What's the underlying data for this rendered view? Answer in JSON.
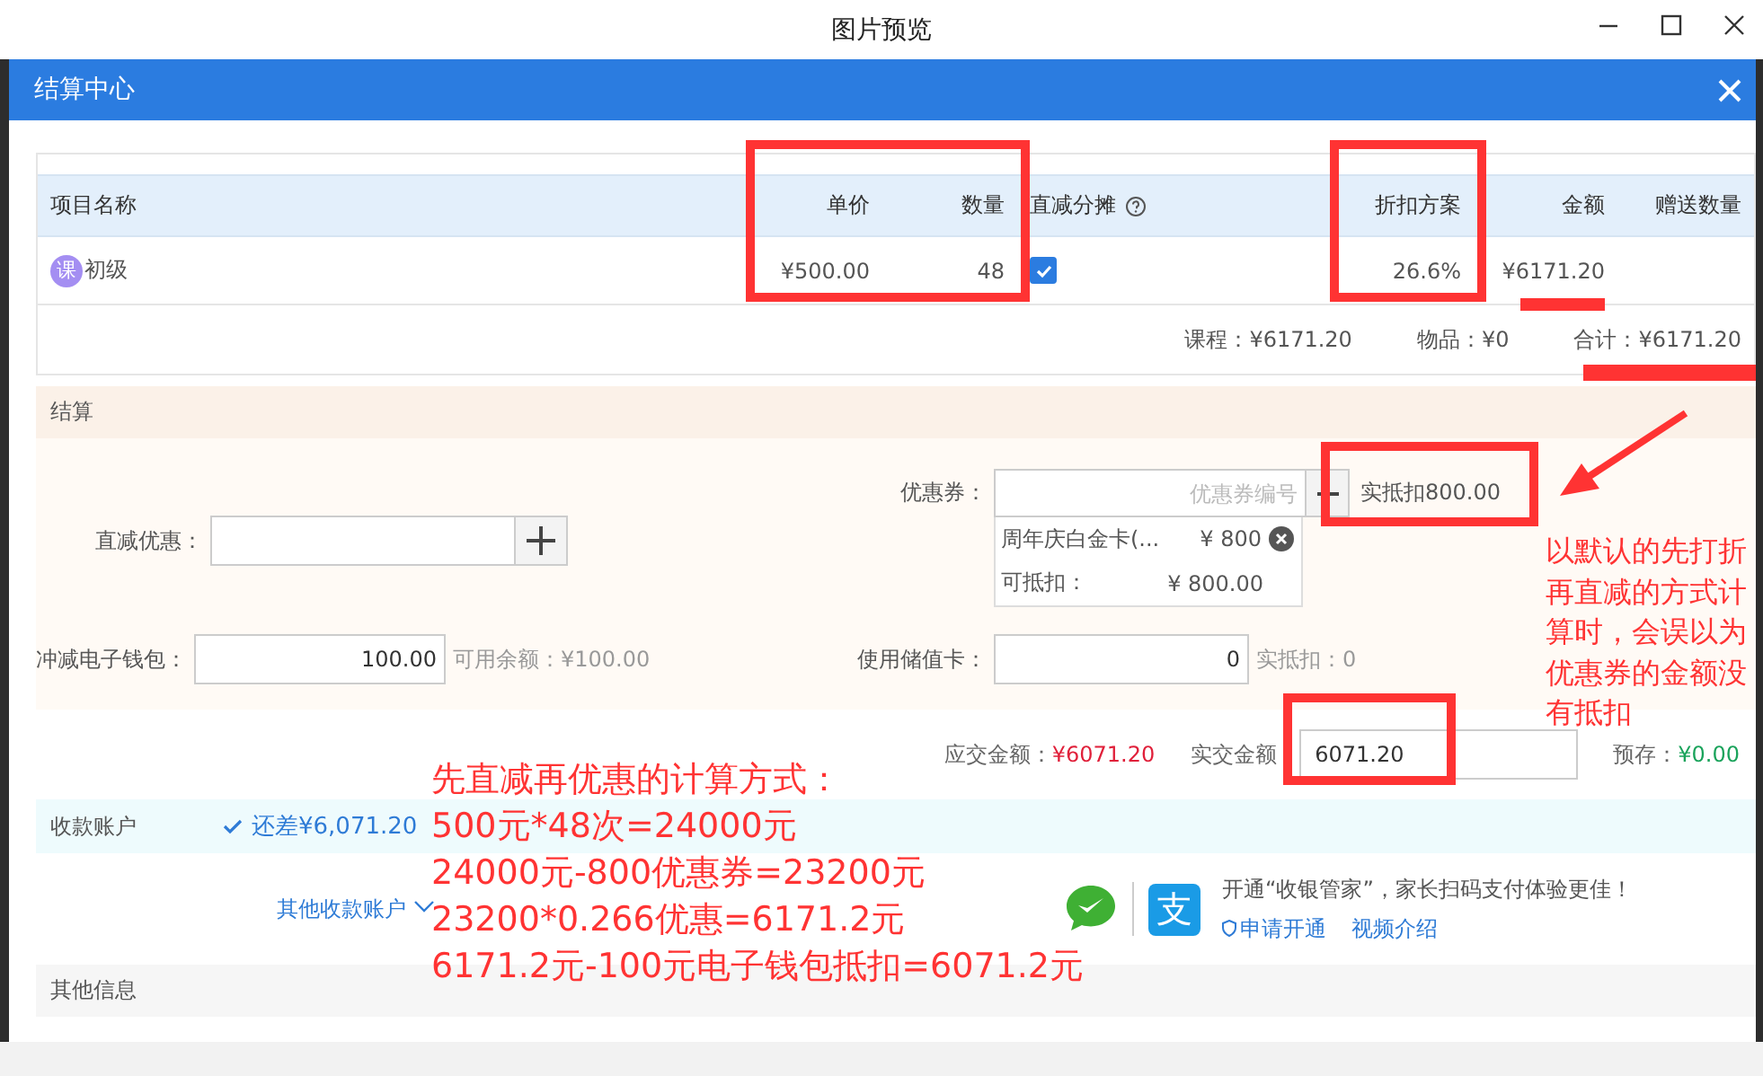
{
  "window": {
    "title": "图片预览"
  },
  "dialog": {
    "title": "结算中心"
  },
  "items_table": {
    "columns": [
      {
        "label": "项目名称"
      },
      {
        "label": "单价"
      },
      {
        "label": "数量"
      },
      {
        "label": "直减分摊",
        "kind": "help"
      },
      {
        "label": "折扣方案"
      },
      {
        "label": "金额"
      },
      {
        "label": "赠送数量"
      }
    ],
    "rows": [
      {
        "badge": "课",
        "name": "初级",
        "unit_price": "¥500.00",
        "quantity": "48",
        "split_discount": true,
        "discount": "26.6%",
        "amount": "¥6171.20"
      }
    ],
    "totals": [
      "课程：¥6171.20",
      "物品：¥0",
      "合计：¥6171.20"
    ]
  },
  "settlement": {
    "title": "结算",
    "direct_discount": {
      "label": "直减优惠："
    },
    "coupon": {
      "label": "优惠券：",
      "placeholder": "优惠券编号",
      "actual": "实抵扣800.00",
      "card": {
        "name": "周年庆白金卡(...",
        "value": "¥ 800",
        "deductible_label": "可抵扣：",
        "deductible": "¥ 800.00"
      }
    },
    "wallet": {
      "label": "冲减电子钱包：",
      "value": "100.00",
      "available": "可用余额：¥100.00"
    },
    "stored_card": {
      "label": "使用储值卡：",
      "value": "0",
      "actual": "实抵扣：0"
    }
  },
  "payment": {
    "due_label": "应交金额：",
    "due": "¥6071.20",
    "paid_label": "实交金额",
    "paid": "6071.20",
    "prepaid_label": "预存：",
    "prepaid": "¥0.00"
  },
  "accounts": {
    "title": "收款账户",
    "status": "还差¥6,071.20",
    "other": "其他收款账户",
    "promo": {
      "alipay_glyph": "支",
      "text": "开通“收银管家”，家长扫码支付体验更佳！",
      "links": [
        "申请开通",
        "视频介绍"
      ]
    }
  },
  "other_info": {
    "title": "其他信息"
  },
  "annotations": {
    "note": "以默认的先打折再直减的方式计算时，会误以为优惠券的金额没有抵扣",
    "calculation": [
      "先直减再优惠的计算方式：",
      "500元*48次=24000元",
      "24000元-800优惠券=23200元",
      "23200*0.266优惠=6171.2元",
      "6171.2元-100元电子钱包抵扣=6071.2元"
    ]
  }
}
